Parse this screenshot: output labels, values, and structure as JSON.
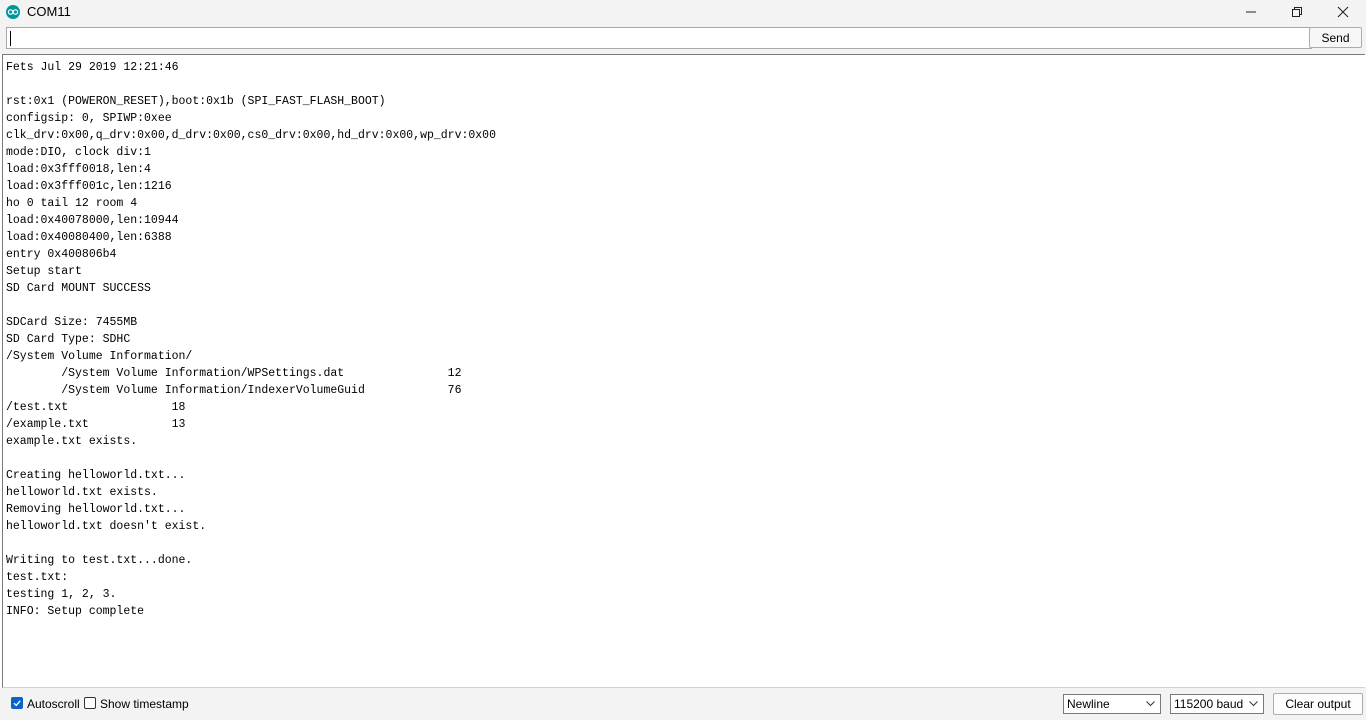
{
  "window": {
    "title": "COM11",
    "accent": "#00979c"
  },
  "send": {
    "input_value": "",
    "button_label": "Send"
  },
  "output": {
    "text": "Fets Jul 29 2019 12:21:46\n\nrst:0x1 (POWERON_RESET),boot:0x1b (SPI_FAST_FLASH_BOOT)\nconfigsip: 0, SPIWP:0xee\nclk_drv:0x00,q_drv:0x00,d_drv:0x00,cs0_drv:0x00,hd_drv:0x00,wp_drv:0x00\nmode:DIO, clock div:1\nload:0x3fff0018,len:4\nload:0x3fff001c,len:1216\nho 0 tail 12 room 4\nload:0x40078000,len:10944\nload:0x40080400,len:6388\nentry 0x400806b4\nSetup start\nSD Card MOUNT SUCCESS\n\nSDCard Size: 7455MB\nSD Card Type: SDHC\n/System Volume Information/\n        /System Volume Information/WPSettings.dat               12\n        /System Volume Information/IndexerVolumeGuid            76\n/test.txt               18\n/example.txt            13\nexample.txt exists.\n\nCreating helloworld.txt...\nhelloworld.txt exists.\nRemoving helloworld.txt...\nhelloworld.txt doesn't exist.\n\nWriting to test.txt...done.\ntest.txt:\ntesting 1, 2, 3.\nINFO: Setup complete"
  },
  "footer": {
    "autoscroll_label": "Autoscroll",
    "autoscroll_checked": true,
    "timestamp_label": "Show timestamp",
    "timestamp_checked": false,
    "line_ending": "Newline",
    "baud_rate": "115200 baud",
    "clear_label": "Clear output",
    "check_color": "#0a64c8"
  }
}
